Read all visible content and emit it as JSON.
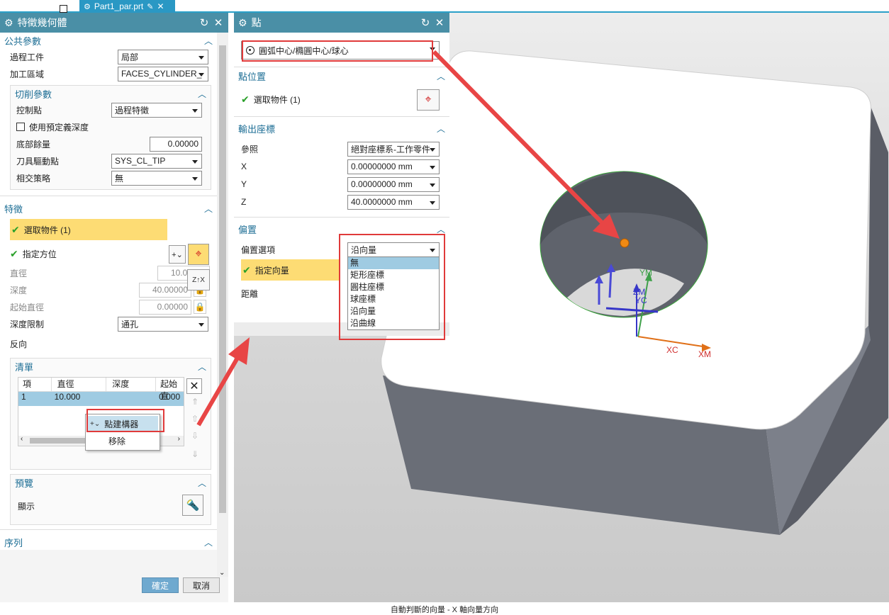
{
  "tabbar": {
    "file_tab": "Part1_par.prt"
  },
  "feature_dialog": {
    "title": "特徵幾何體",
    "common_params": {
      "header": "公共參數",
      "process_workpiece_label": "過程工件",
      "process_workpiece_value": "局部",
      "machining_area_label": "加工區域",
      "machining_area_value": "FACES_CYLINDER_",
      "cutting_params": {
        "header": "切削參數",
        "control_point_label": "控制點",
        "control_point_value": "過程特徵",
        "use_default_depth_label": "使用預定義深度",
        "bottom_stock_label": "底部餘量",
        "bottom_stock_value": "0.00000",
        "tool_drive_point_label": "刀具驅動點",
        "tool_drive_point_value": "SYS_CL_TIP",
        "intersection_label": "相交策略",
        "intersection_value": "無"
      }
    },
    "feature": {
      "header": "特徵",
      "select_object_label": "選取物件 (1)",
      "specify_orientation_label": "指定方位",
      "diameter_label": "直徑",
      "diameter_value": "10.00000",
      "depth_label": "深度",
      "depth_value": "40.00000",
      "start_diameter_label": "起始直徑",
      "start_diameter_value": "0.00000",
      "depth_limit_label": "深度限制",
      "depth_limit_value": "通孔",
      "reverse_label": "反向"
    },
    "list": {
      "header": "清單",
      "columns": [
        "項",
        "直徑",
        "深度",
        "起始直"
      ],
      "rows": [
        [
          "1",
          "10.000",
          "",
          "0.000"
        ]
      ]
    },
    "context_menu": {
      "item1": "點建構器",
      "item2": "移除"
    },
    "preview": {
      "header": "預覽",
      "display_label": "顯示"
    },
    "sequence": {
      "header": "序列"
    },
    "ok_label": "確定",
    "cancel_label": "取消"
  },
  "point_dialog": {
    "title": "點",
    "type_value": "圓弧中心/橢圓中心/球心",
    "point_location": {
      "header": "點位置",
      "select_object_label": "選取物件 (1)"
    },
    "output_coords": {
      "header": "輸出座標",
      "reference_label": "參照",
      "reference_value": "絕對座標系-工作零件",
      "x_label": "X",
      "x_value": "0.00000000 mm",
      "y_label": "Y",
      "y_value": "0.00000000 mm",
      "z_label": "Z",
      "z_value": "40.0000000 mm"
    },
    "offset": {
      "header": "偏置",
      "option_label": "偏置選項",
      "option_value": "沿向量",
      "vector_label": "指定向量",
      "distance_label": "距離",
      "dropdown_options": [
        "無",
        "矩形座標",
        "圓柱座標",
        "球座標",
        "沿向量",
        "沿曲線"
      ]
    }
  },
  "viewport": {
    "labels": {
      "ym": "YM",
      "zm": "ZM",
      "yc": "YC",
      "xc": "XC",
      "xm": "XM"
    }
  },
  "status_text": "自動判斷的向量 - X 軸向量方向",
  "colors": {
    "title_bar": "#4a8fa6",
    "accent": "#1d6e95",
    "highlight": "#fddc74",
    "annotation": "#e03a3a",
    "selected_row": "#9fcbe2"
  }
}
